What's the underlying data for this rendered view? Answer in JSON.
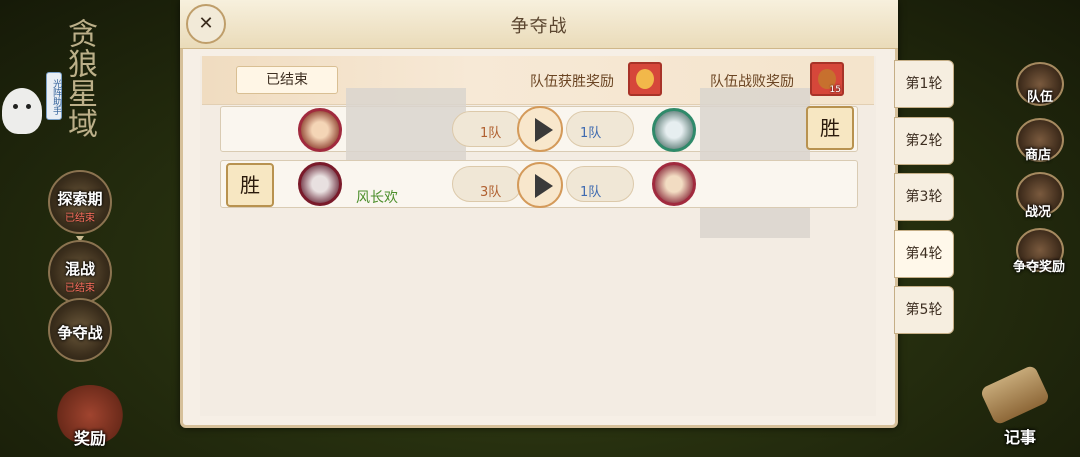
{
  "title": "争夺战",
  "close_icon": "close-icon",
  "left_sidebar": {
    "region_title": "贪狼星域",
    "helper_tag": "光阵助手",
    "stages": [
      {
        "name": "探索期",
        "status": "已结束"
      },
      {
        "name": "混战",
        "status": "已结束"
      },
      {
        "name": "争夺战",
        "status": ""
      }
    ],
    "reward_label": "奖励"
  },
  "right_sidebar": {
    "buttons": [
      "队伍",
      "商店",
      "战况",
      "争夺奖励"
    ],
    "record_label": "记事"
  },
  "status_bar": {
    "status_label": "已结束",
    "win_reward_label": "队伍获胜奖励",
    "lose_reward_label": "队伍战败奖励",
    "lose_reward_count": "15"
  },
  "matches": [
    {
      "left_win": "",
      "left_team": "1队",
      "right_team": "1队",
      "left_name": "",
      "right_win": "胜"
    },
    {
      "left_win": "胜",
      "left_team": "3队",
      "right_team": "1队",
      "left_name": "风长欢",
      "right_win": ""
    }
  ],
  "round_tabs": [
    "第1轮",
    "第2轮",
    "第3轮",
    "第4轮",
    "第5轮"
  ],
  "active_round": "第4轮",
  "colors": {
    "panel_bg": "#f6efe6",
    "win_text": "#4c8f2c",
    "team_left": "#b06030",
    "team_right": "#3e6ab0"
  }
}
